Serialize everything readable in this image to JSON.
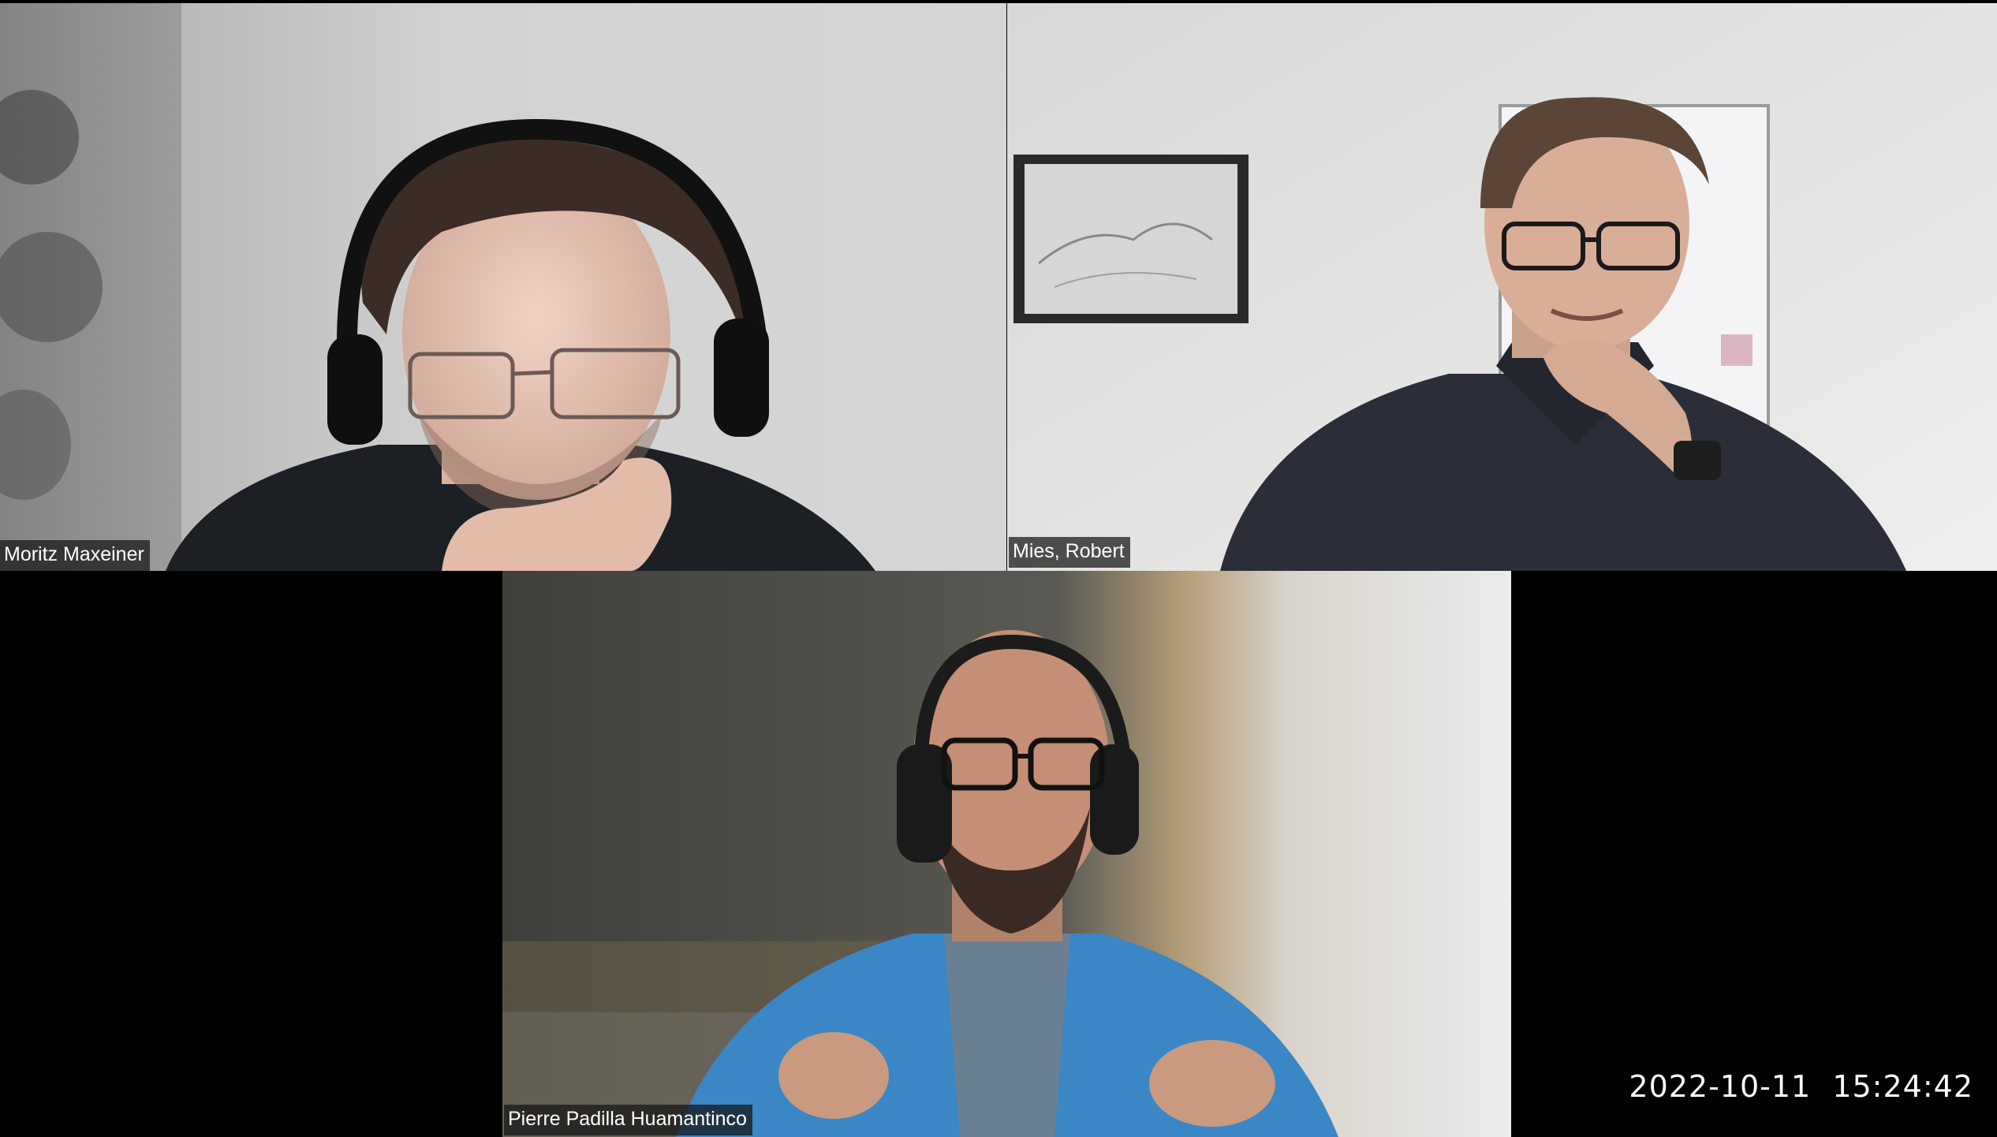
{
  "participants": [
    {
      "name": "Moritz Maxeiner"
    },
    {
      "name": "Mies, Robert"
    },
    {
      "name": "Pierre Padilla Huamantinco"
    }
  ],
  "timestamp": {
    "date": "2022-10-11",
    "time": "15:24:42"
  }
}
